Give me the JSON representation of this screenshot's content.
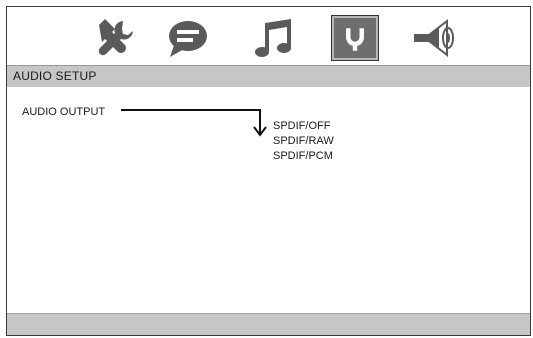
{
  "icons": [
    {
      "name": "wrench-icon",
      "active": false
    },
    {
      "name": "speech-bubble-icon",
      "active": false
    },
    {
      "name": "music-note-icon",
      "active": false
    },
    {
      "name": "audio-plug-icon",
      "active": true
    },
    {
      "name": "speaker-icon",
      "active": false
    }
  ],
  "header": {
    "title": "AUDIO SETUP"
  },
  "setting": {
    "label": "AUDIO OUTPUT",
    "options": [
      "SPDIF/OFF",
      "SPDIF/RAW",
      "SPDIF/PCM"
    ]
  },
  "colors": {
    "bar": "#c6c6c6",
    "active_tab": "#6e6e6e",
    "icon": "#5a5a5a"
  }
}
